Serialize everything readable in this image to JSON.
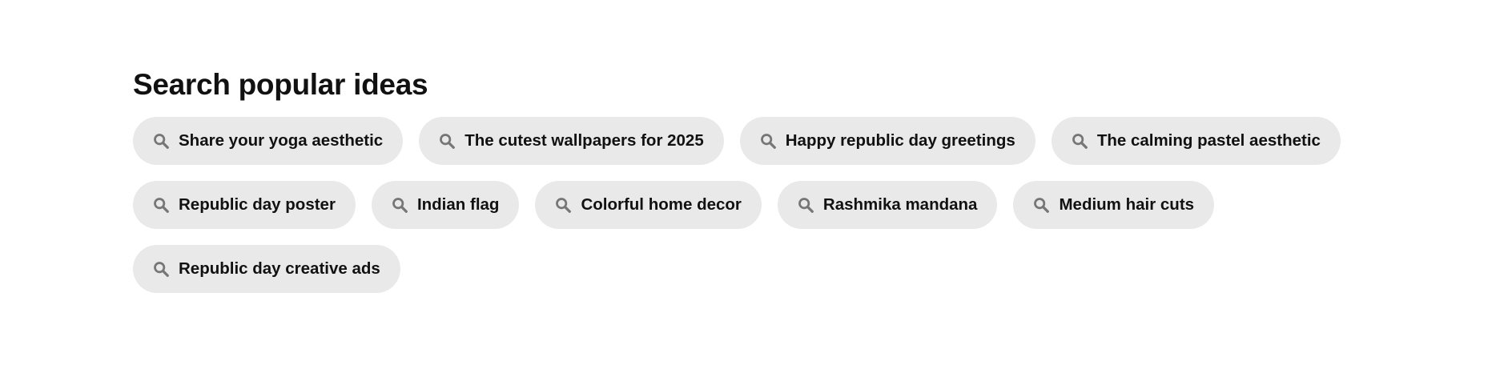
{
  "section": {
    "title": "Search popular ideas"
  },
  "colors": {
    "chip_background": "#e9e9e9",
    "text": "#111111",
    "icon": "#767676"
  },
  "rows": [
    [
      {
        "label": "Share your yoga aesthetic",
        "icon": "search-icon"
      },
      {
        "label": "The cutest wallpapers for 2025",
        "icon": "search-icon"
      },
      {
        "label": "Happy republic day greetings",
        "icon": "search-icon"
      },
      {
        "label": "The calming pastel aesthetic",
        "icon": "search-icon"
      }
    ],
    [
      {
        "label": "Republic day poster",
        "icon": "search-icon"
      },
      {
        "label": "Indian flag",
        "icon": "search-icon"
      },
      {
        "label": "Colorful home decor",
        "icon": "search-icon"
      },
      {
        "label": "Rashmika mandana",
        "icon": "search-icon"
      },
      {
        "label": "Medium hair cuts",
        "icon": "search-icon"
      }
    ],
    [
      {
        "label": "Republic day creative ads",
        "icon": "search-icon"
      }
    ]
  ]
}
